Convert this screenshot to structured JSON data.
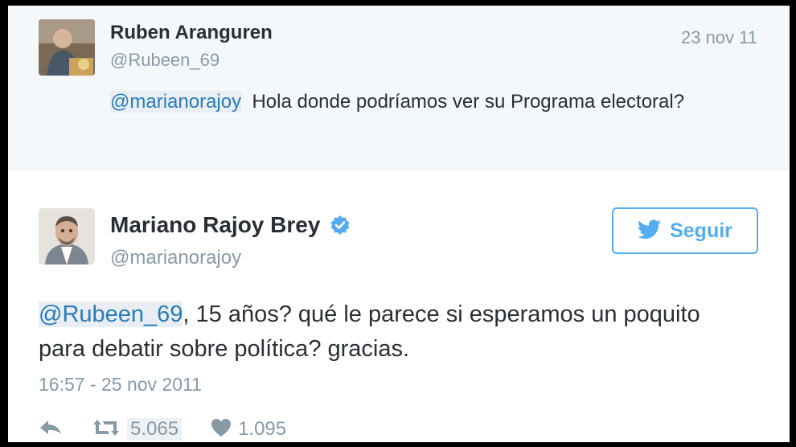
{
  "reply_tweet": {
    "author_name": "Ruben Aranguren",
    "author_handle": "@Rubeen_69",
    "date": "23 nov 11",
    "mention": "@marianorajoy",
    "text": "Hola donde podríamos ver su Programa electoral?"
  },
  "main_tweet": {
    "author_name": "Mariano Rajoy Brey",
    "author_handle": "@marianorajoy",
    "verified": true,
    "follow_label": "Seguir",
    "mention": "@Rubeen_69",
    "text": ", 15 años? qué le parece si esperamos un poquito para debatir sobre política? gracias.",
    "timestamp": "16:57 - 25 nov 2011",
    "retweet_count": "5.065",
    "like_count": "1.095"
  },
  "colors": {
    "link": "#2b7bb9",
    "twitter_blue": "#55acee",
    "muted": "#8899a6",
    "text": "#292f33"
  },
  "icons": {
    "verified": "verified-badge-icon",
    "bird": "twitter-bird-icon",
    "reply": "reply-arrow-icon",
    "retweet": "retweet-icon",
    "like": "heart-icon"
  }
}
